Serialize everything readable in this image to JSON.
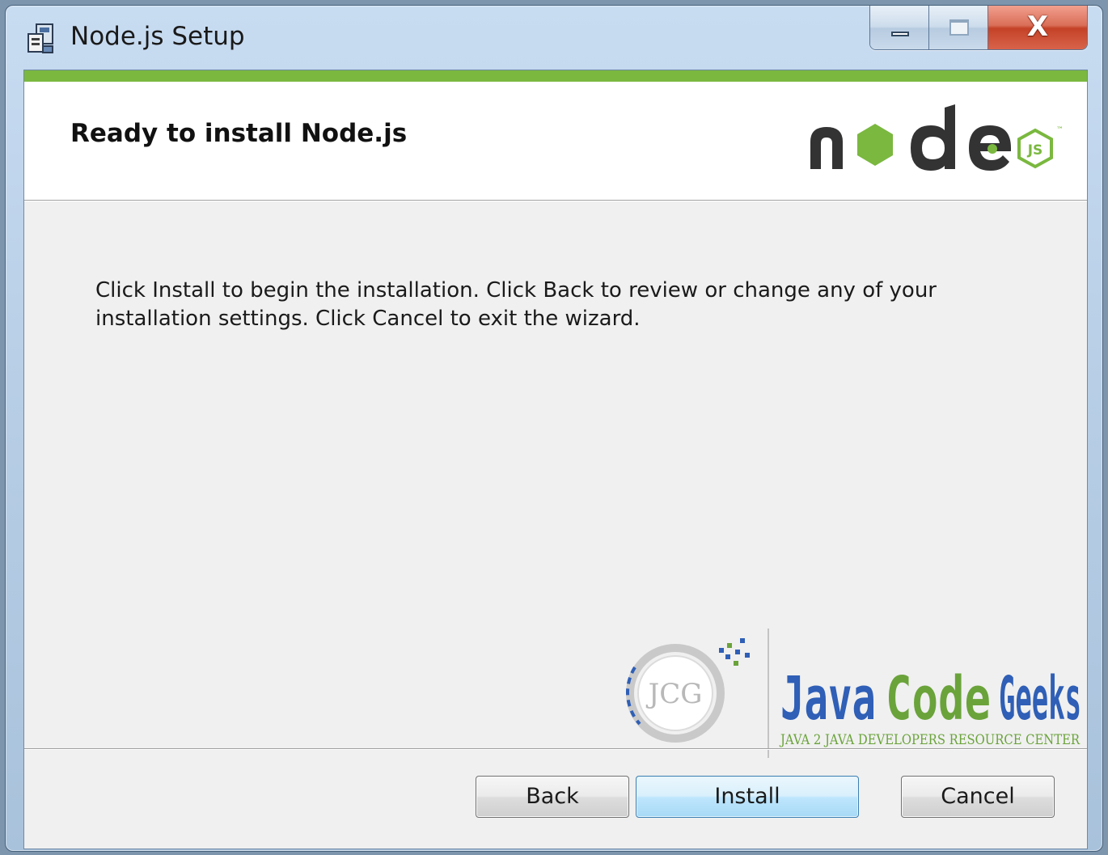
{
  "window": {
    "title": "Node.js Setup",
    "app_icon": "installer-icon",
    "controls": {
      "minimize_icon": "minimize-icon",
      "maximize_icon": "maximize-icon",
      "close_label": "X"
    }
  },
  "header": {
    "heading": "Ready to install Node.js",
    "logo_text": "node",
    "logo_badge": "JS",
    "accent_color": "#7ab83f"
  },
  "body": {
    "description": "Click Install to begin the installation. Click Back to review or change any of your installation settings. Click Cancel to exit the wizard."
  },
  "watermark": {
    "badge_text": "JCG",
    "brand_word_1": "Java",
    "brand_word_2": "Code",
    "brand_word_3": "Geeks",
    "tagline": "JAVA 2 JAVA DEVELOPERS RESOURCE CENTER",
    "brand_blue": "#2f5fb6",
    "brand_green": "#6aa33a"
  },
  "footer": {
    "back_label": "Back",
    "install_label": "Install",
    "cancel_label": "Cancel"
  }
}
